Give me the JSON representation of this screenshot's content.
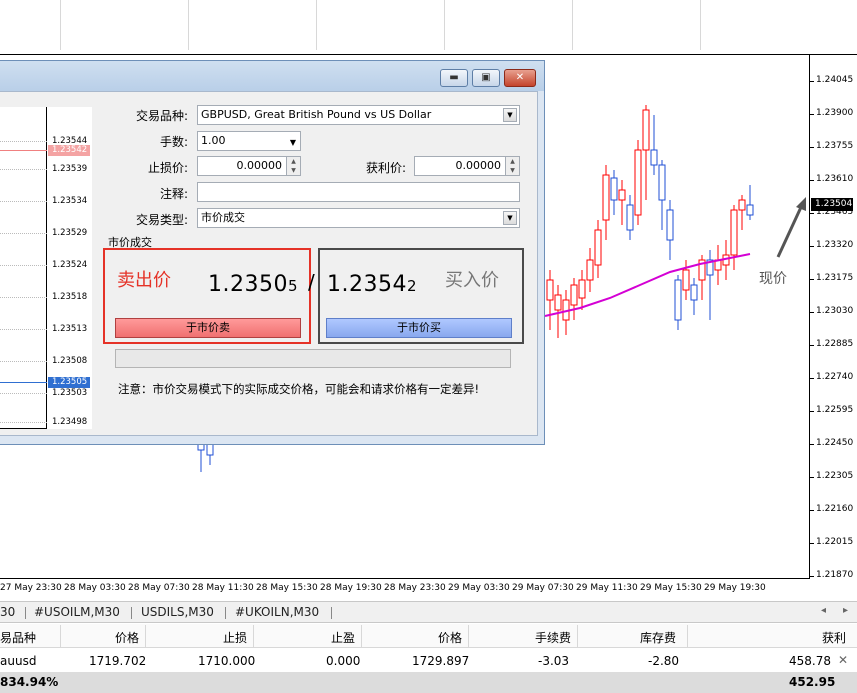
{
  "chart": {
    "price_axis": [
      "1.24045",
      "1.23900",
      "1.23755",
      "1.23610",
      "1.23465",
      "1.23320",
      "1.23175",
      "1.23030",
      "1.22885",
      "1.22740",
      "1.22595",
      "1.22450",
      "1.22305",
      "1.22160",
      "1.22015",
      "1.21870"
    ],
    "current_price": "1.23504",
    "time_axis": [
      "27 May 23:30",
      "28 May 03:30",
      "28 May 07:30",
      "28 May 11:30",
      "28 May 15:30",
      "28 May 19:30",
      "28 May 23:30",
      "29 May 03:30",
      "29 May 07:30",
      "29 May 11:30",
      "29 May 15:30",
      "29 May 19:30"
    ],
    "annotation": "现价",
    "colors": {
      "bull": "#ff0000",
      "bear": "#1f4fd6",
      "ma": "#d400d4"
    }
  },
  "dialog": {
    "mini_chart": {
      "labels": [
        "1.23544",
        "1.23539",
        "1.23534",
        "1.23529",
        "1.23524",
        "1.23518",
        "1.23513",
        "1.23508",
        "1.23503",
        "1.23498"
      ],
      "ask_label": "1.23542",
      "bid_label": "1.23505"
    },
    "form": {
      "symbol_label": "交易品种:",
      "symbol_value": "GBPUSD, Great British Pound vs US Dollar",
      "volume_label": "手数:",
      "volume_value": "1.00",
      "sl_label": "止损价:",
      "sl_value": "0.00000",
      "tp_label": "获利价:",
      "tp_value": "0.00000",
      "comment_label": "注释:",
      "comment_value": "",
      "type_label": "交易类型:",
      "type_value": "市价成交"
    },
    "section_label": "市价成交",
    "sell": {
      "caption": "卖出价",
      "price_main": "1.2350",
      "price_small": "5",
      "button": "于市价卖"
    },
    "slash": "/",
    "buy": {
      "caption": "买入价",
      "price_main": "1.2354",
      "price_small": "2",
      "button": "于市价买"
    },
    "notice": "注意：市价交易模式下的实际成交价格，可能会和请求价格有一定差异!"
  },
  "tabs": [
    "30",
    "#USOILM,M30",
    "USDILS,M30",
    "#UKOILN,M30"
  ],
  "table": {
    "headers": [
      "易品种",
      "价格",
      "止损",
      "止盈",
      "价格",
      "手续费",
      "库存费",
      "获利"
    ],
    "row": {
      "symbol": "auusd",
      "price": "1719.702",
      "sl": "1710.000",
      "tp": "0.000",
      "price2": "1729.897",
      "commission": "-3.03",
      "swap": "-2.80",
      "profit": "458.78"
    },
    "summary": {
      "left": "834.94%",
      "right": "452.95"
    }
  }
}
